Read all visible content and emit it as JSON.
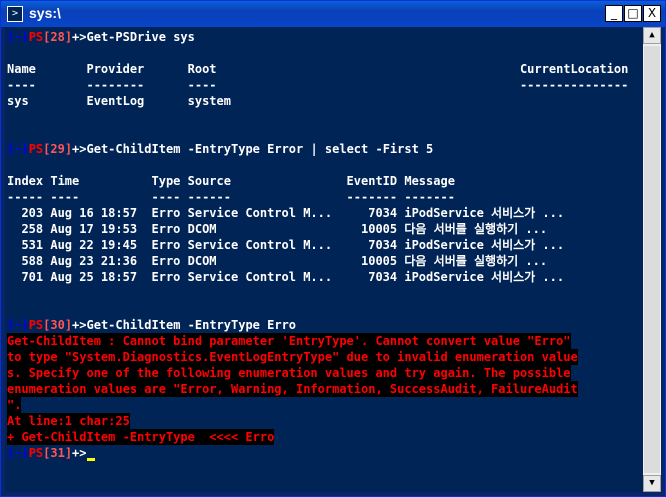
{
  "window": {
    "title": "sys:\\",
    "minimize": "_",
    "maximize": "□",
    "close": "X"
  },
  "scroll": {
    "up": "▲",
    "down": "▼"
  },
  "prompts": {
    "p28": {
      "open": "[~]",
      "ps": "PS",
      "num": "[28]",
      "tail": "+>",
      "cmd": "Get-PSDrive sys"
    },
    "p29": {
      "open": "[~]",
      "ps": "PS",
      "num": "[29]",
      "tail": "+>",
      "cmd": "Get-ChildItem -EntryType Error | select -First 5"
    },
    "p30": {
      "open": "[~]",
      "ps": "PS",
      "num": "[30]",
      "tail": "+>",
      "cmd": "Get-ChildItem -EntryType Erro"
    },
    "p31": {
      "open": "[~]",
      "ps": "PS",
      "num": "[31]",
      "tail": "+>"
    }
  },
  "drive": {
    "header": "Name       Provider      Root                                          CurrentLocation",
    "dashes": "----       --------      ----                                          ---------------",
    "row": "sys        EventLog      system"
  },
  "events": {
    "header": "Index Time          Type Source                EventID Message",
    "dashes": "----- ----          ---- ------                ------- -------",
    "rows": [
      "  203 Aug 16 18:57  Erro Service Control M...     7034 iPodService 서비스가 ...",
      "  258 Aug 17 19:53  Erro DCOM                    10005 다음 서버를 실행하기 ...",
      "  531 Aug 22 19:45  Erro Service Control M...     7034 iPodService 서비스가 ...",
      "  588 Aug 23 21:36  Erro DCOM                    10005 다음 서버를 실행하기 ...",
      "  701 Aug 25 18:57  Erro Service Control M...     7034 iPodService 서비스가 ..."
    ]
  },
  "error": {
    "lines": [
      "Get-ChildItem : Cannot bind parameter 'EntryType'. Cannot convert value \"Erro\"",
      "to type \"System.Diagnostics.EventLogEntryType\" due to invalid enumeration value",
      "s. Specify one of the following enumeration values and try again. The possible",
      "enumeration values are \"Error, Warning, Information, SuccessAudit, FailureAudit",
      "\".",
      "At line:1 char:25",
      "+ Get-ChildItem -EntryType  <<<< Erro"
    ]
  }
}
